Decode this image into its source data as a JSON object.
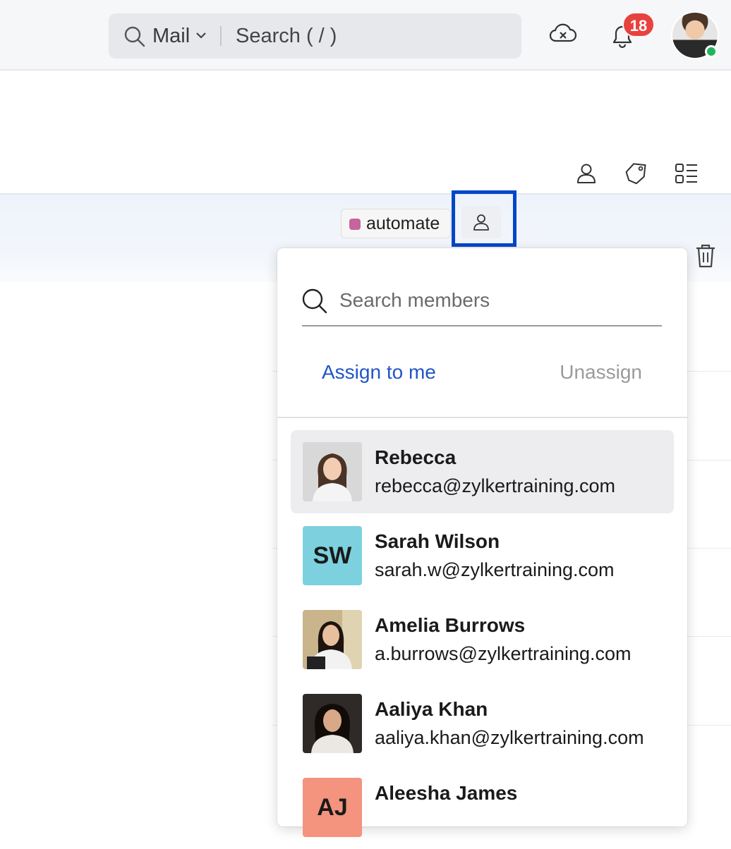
{
  "header": {
    "search_scope": "Mail",
    "search_placeholder": "Search ( / )",
    "notification_count": "18"
  },
  "toolbar": {
    "icons": [
      "contact-icon",
      "tag-icon",
      "view-list-icon"
    ]
  },
  "selected_row": {
    "tag_label": "automate",
    "tag_color": "#c6649c"
  },
  "assign_dropdown": {
    "search_placeholder": "Search members",
    "assign_to_me": "Assign to me",
    "unassign": "Unassign",
    "members": [
      {
        "name": "Rebecca",
        "email": "rebecca@zylkertraining.com",
        "initials": "",
        "avatar_color": "#c9c9c9"
      },
      {
        "name": "Sarah Wilson",
        "email": "sarah.w@zylkertraining.com",
        "initials": "SW",
        "avatar_color": "#7dd1df"
      },
      {
        "name": "Amelia Burrows",
        "email": "a.burrows@zylkertraining.com",
        "initials": "",
        "avatar_color": "#b8a27a"
      },
      {
        "name": "Aaliya Khan",
        "email": "aaliya.khan@zylkertraining.com",
        "initials": "",
        "avatar_color": "#3a3430"
      },
      {
        "name": "Aleesha James",
        "email": "",
        "initials": "AJ",
        "avatar_color": "#f4937e"
      }
    ]
  },
  "colors": {
    "accent_link": "#2156c4",
    "highlight_box": "#0046c8",
    "badge": "#e8423f",
    "online": "#22b35e"
  }
}
